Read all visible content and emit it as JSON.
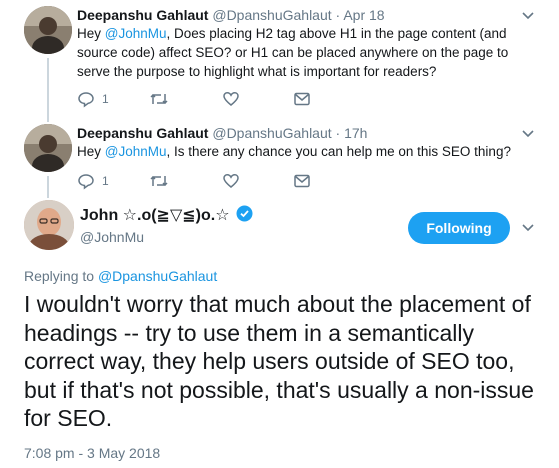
{
  "replies": [
    {
      "display_name": "Deepanshu Gahlaut",
      "handle": "@DpanshuGahlaut",
      "separator": "·",
      "time": "Apr 18",
      "text_parts": [
        "Hey ",
        "@JohnMu",
        ", Does placing H2 tag above H1 in the page content (and source code) affect SEO? or H1 can be placed anywhere on the page to serve the purpose to highlight what is important for readers?"
      ],
      "reply_count": "1",
      "retweet_count": "",
      "like_count": ""
    },
    {
      "display_name": "Deepanshu Gahlaut",
      "handle": "@DpanshuGahlaut",
      "separator": "·",
      "time": "17h",
      "text_parts": [
        "Hey ",
        "@JohnMu",
        ", Is there any chance you can help me on this SEO thing?"
      ],
      "reply_count": "1",
      "retweet_count": "",
      "like_count": ""
    }
  ],
  "main_tweet": {
    "display_name": "John ☆.o(≧▽≦)o.☆",
    "handle": "@JohnMu",
    "follow_label": "Following",
    "replying_prefix": "Replying to ",
    "replying_to": "@DpanshuGahlaut",
    "text": "I wouldn't worry that much about the placement of headings -- try to use them in a semantically correct way, they help users outside of SEO too, but if that's not possible, that's usually a non-issue for SEO.",
    "timestamp": "7:08 pm - 3 May 2018"
  },
  "colors": {
    "accent": "#1da1f2",
    "link": "#1b95e0",
    "muted": "#657786",
    "thread_line": "#ccd6dd"
  },
  "icons": [
    "reply-icon",
    "retweet-icon",
    "like-icon",
    "dm-icon",
    "caret-down-icon",
    "verified-badge-icon"
  ]
}
